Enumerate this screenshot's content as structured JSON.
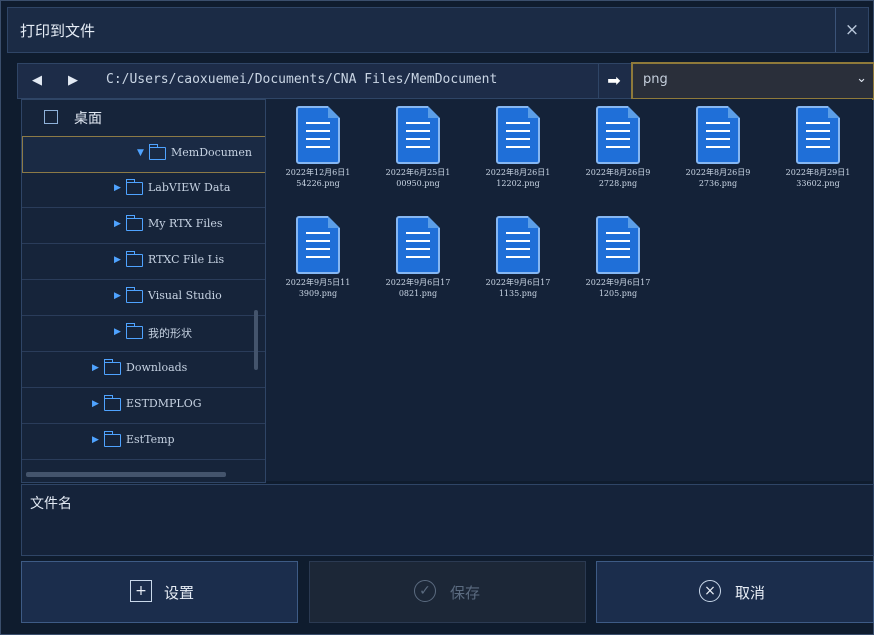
{
  "dialog": {
    "title": "打印到文件",
    "close": "×"
  },
  "toolbar": {
    "back": "◀",
    "forward": "▶",
    "path": "C:/Users/caoxuemei/Documents/CNA Files/MemDocument",
    "go": "➡",
    "filter_value": "png",
    "filter_chevron": "⌄"
  },
  "tree": {
    "root_label": "桌面",
    "items": [
      {
        "label": "MemDocumen",
        "indent": 3,
        "selected": true,
        "arrow": "▼"
      },
      {
        "label": "LabVIEW Data",
        "indent": 2,
        "arrow": "▶"
      },
      {
        "label": "My RTX Files",
        "indent": 2,
        "arrow": "▶"
      },
      {
        "label": "RTXC File Lis",
        "indent": 2,
        "arrow": "▶"
      },
      {
        "label": "Visual Studio",
        "indent": 2,
        "arrow": "▶"
      },
      {
        "label": "我的形状",
        "indent": 2,
        "arrow": "▶"
      },
      {
        "label": "Downloads",
        "indent": 1,
        "arrow": "▶"
      },
      {
        "label": "ESTDMPLOG",
        "indent": 1,
        "arrow": "▶"
      },
      {
        "label": "EstTemp",
        "indent": 1,
        "arrow": "▶"
      }
    ]
  },
  "files": [
    {
      "line1": "2022年12月6日1",
      "line2": "54226.png"
    },
    {
      "line1": "2022年6月25日1",
      "line2": "00950.png"
    },
    {
      "line1": "2022年8月26日1",
      "line2": "12202.png"
    },
    {
      "line1": "2022年8月26日9",
      "line2": "2728.png"
    },
    {
      "line1": "2022年8月26日9",
      "line2": "2736.png"
    },
    {
      "line1": "2022年8月29日1",
      "line2": "33602.png"
    },
    {
      "line1": "2022年9月5日11",
      "line2": "3909.png"
    },
    {
      "line1": "2022年9月6日17",
      "line2": "0821.png"
    },
    {
      "line1": "2022年9月6日17",
      "line2": "1135.png"
    },
    {
      "line1": "2022年9月6日17",
      "line2": "1205.png"
    }
  ],
  "filename": {
    "label": "文件名"
  },
  "buttons": {
    "settings": {
      "label": "设置",
      "icon": "+"
    },
    "save": {
      "label": "保存",
      "icon": "✓"
    },
    "cancel": {
      "label": "取消",
      "icon": "×"
    }
  }
}
